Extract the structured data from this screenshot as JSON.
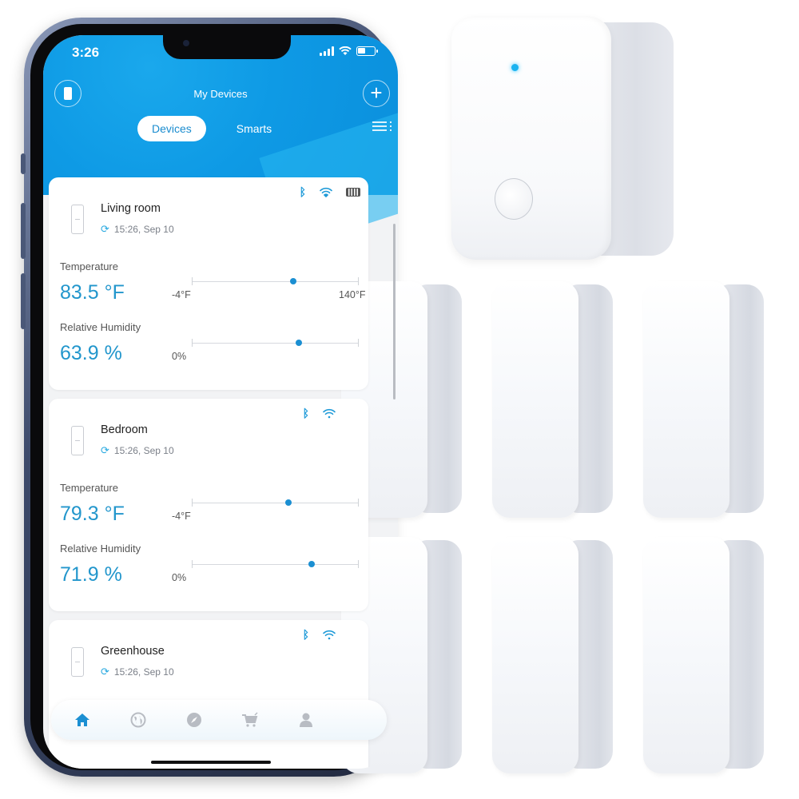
{
  "status_bar": {
    "time": "3:26"
  },
  "header": {
    "title": "My Devices",
    "add_label": "+",
    "tabs": [
      {
        "label": "Devices",
        "active": true
      },
      {
        "label": "Smarts",
        "active": false
      }
    ]
  },
  "devices": [
    {
      "name": "Living room",
      "last_sync": "15:26,  Sep 10",
      "connectivity": [
        "bluetooth-icon",
        "wifi-icon",
        "battery-full-icon"
      ],
      "temperature": {
        "label": "Temperature",
        "value": "83.5 °F",
        "numeric": 83.5,
        "min_label": "-4°F",
        "max_label": "140°F",
        "min": -4,
        "max": 140
      },
      "humidity": {
        "label": "Relative Humidity",
        "value": "63.9 %",
        "numeric": 63.9,
        "min_label": "0%",
        "min": 0,
        "max": 100
      }
    },
    {
      "name": "Bedroom",
      "last_sync": "15:26,  Sep 10",
      "connectivity": [
        "bluetooth-icon",
        "wifi-icon"
      ],
      "temperature": {
        "label": "Temperature",
        "value": "79.3 °F",
        "numeric": 79.3,
        "min_label": "-4°F",
        "min": -4,
        "max": 140
      },
      "humidity": {
        "label": "Relative Humidity",
        "value": "71.9 %",
        "numeric": 71.9,
        "min_label": "0%",
        "min": 0,
        "max": 100
      }
    },
    {
      "name": "Greenhouse",
      "last_sync": "15:26,  Sep 10",
      "connectivity": [
        "bluetooth-icon",
        "wifi-icon"
      ]
    }
  ],
  "tab_bar": {
    "items": [
      {
        "icon": "home-icon",
        "active": true
      },
      {
        "icon": "globe-icon",
        "active": false
      },
      {
        "icon": "compass-icon",
        "active": false
      },
      {
        "icon": "cart-icon",
        "active": false
      },
      {
        "icon": "user-icon",
        "active": false
      }
    ]
  },
  "colors": {
    "brand_blue": "#0e9ae5",
    "value_blue": "#2296cc",
    "slider_dot": "#1b8fd2",
    "hub_led": "#1ab3f0"
  },
  "hardware": {
    "hub_count": 1,
    "sensor_count": 6
  }
}
